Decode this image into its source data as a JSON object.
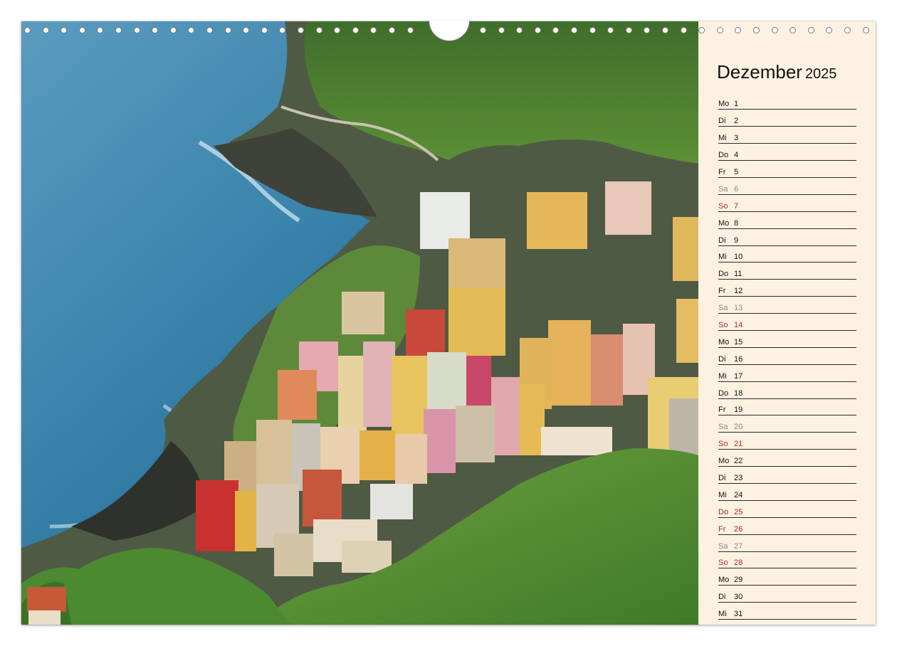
{
  "calendar": {
    "month": "Dezember",
    "year": "2025",
    "days": [
      {
        "day": "Mo",
        "date": "1",
        "type": "weekday"
      },
      {
        "day": "Di",
        "date": "2",
        "type": "weekday"
      },
      {
        "day": "Mi",
        "date": "3",
        "type": "weekday"
      },
      {
        "day": "Do",
        "date": "4",
        "type": "weekday"
      },
      {
        "day": "Fr",
        "date": "5",
        "type": "weekday"
      },
      {
        "day": "Sa",
        "date": "6",
        "type": "saturday"
      },
      {
        "day": "So",
        "date": "7",
        "type": "holiday"
      },
      {
        "day": "Mo",
        "date": "8",
        "type": "weekday"
      },
      {
        "day": "Di",
        "date": "9",
        "type": "weekday"
      },
      {
        "day": "Mi",
        "date": "10",
        "type": "weekday"
      },
      {
        "day": "Do",
        "date": "11",
        "type": "weekday"
      },
      {
        "day": "Fr",
        "date": "12",
        "type": "weekday"
      },
      {
        "day": "Sa",
        "date": "13",
        "type": "saturday"
      },
      {
        "day": "So",
        "date": "14",
        "type": "holiday"
      },
      {
        "day": "Mo",
        "date": "15",
        "type": "weekday"
      },
      {
        "day": "Di",
        "date": "16",
        "type": "weekday"
      },
      {
        "day": "Mi",
        "date": "17",
        "type": "weekday"
      },
      {
        "day": "Do",
        "date": "18",
        "type": "weekday"
      },
      {
        "day": "Fr",
        "date": "19",
        "type": "weekday"
      },
      {
        "day": "Sa",
        "date": "20",
        "type": "saturday"
      },
      {
        "day": "So",
        "date": "21",
        "type": "holiday"
      },
      {
        "day": "Mo",
        "date": "22",
        "type": "weekday"
      },
      {
        "day": "Di",
        "date": "23",
        "type": "weekday"
      },
      {
        "day": "Mi",
        "date": "24",
        "type": "weekday"
      },
      {
        "day": "Do",
        "date": "25",
        "type": "holiday"
      },
      {
        "day": "Fr",
        "date": "26",
        "type": "holiday"
      },
      {
        "day": "Sa",
        "date": "27",
        "type": "saturday"
      },
      {
        "day": "So",
        "date": "28",
        "type": "holiday"
      },
      {
        "day": "Mo",
        "date": "29",
        "type": "weekday"
      },
      {
        "day": "Di",
        "date": "30",
        "type": "weekday"
      },
      {
        "day": "Mi",
        "date": "31",
        "type": "weekday"
      }
    ]
  },
  "colors": {
    "sidebar_background": "#fdf1e2",
    "holiday_red": "#b12a26",
    "saturday_gray": "#8d8a86",
    "sea_blue": "#3c7fa6",
    "vegetation_green": "#4e8a34"
  }
}
